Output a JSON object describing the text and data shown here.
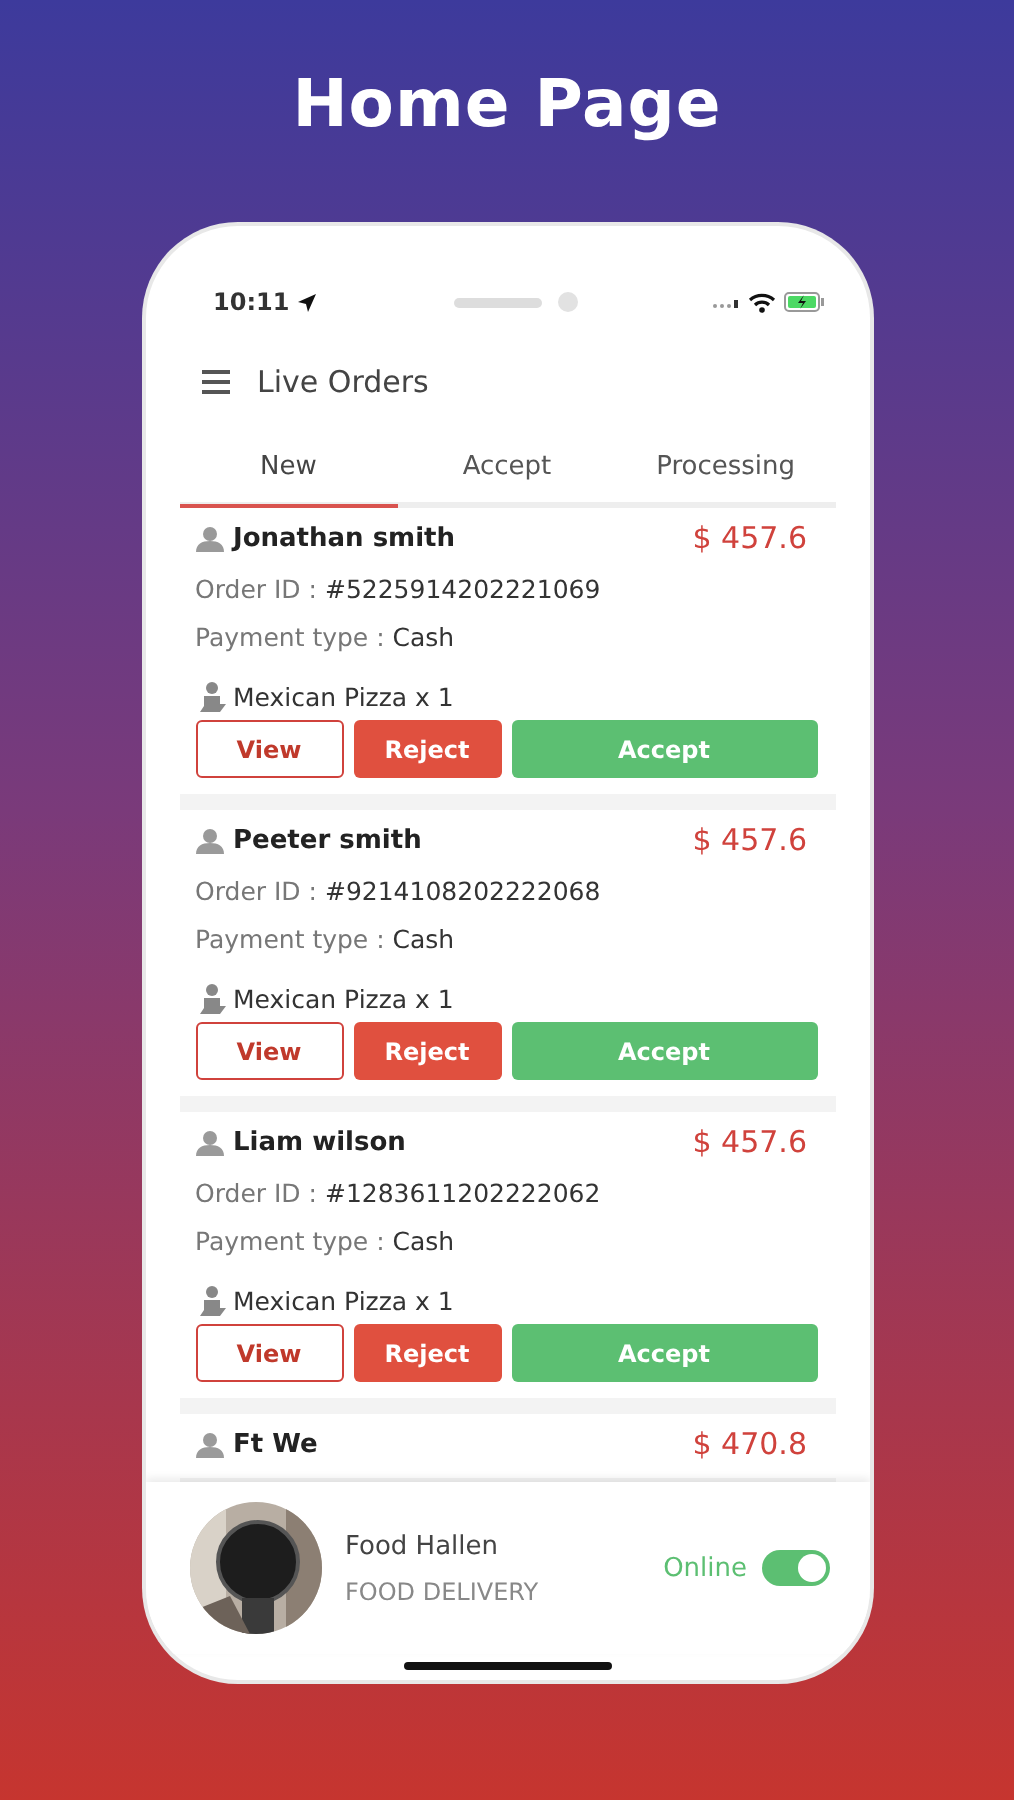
{
  "page_title": "Home Page",
  "status_bar": {
    "time": "10:11"
  },
  "header": {
    "title": "Live Orders"
  },
  "tabs": [
    {
      "label": "New",
      "selected": true
    },
    {
      "label": "Accept",
      "selected": false
    },
    {
      "label": "Processing",
      "selected": false
    }
  ],
  "orders": [
    {
      "name": "Jonathan smith",
      "price": "$ 457.6",
      "order_id_label": "Order ID :",
      "order_id": "#5225914202221069",
      "payment_label": "Payment type :",
      "payment": "Cash",
      "item": "Mexican Pizza x 1",
      "actions": [
        {
          "label": "View",
          "kind": "outline"
        },
        {
          "label": "Reject",
          "kind": "danger"
        },
        {
          "label": "Accept",
          "kind": "success"
        }
      ]
    },
    {
      "name": "Peeter smith",
      "price": "$ 457.6",
      "order_id_label": "Order ID :",
      "order_id": "#9214108202222068",
      "payment_label": "Payment type :",
      "payment": "Cash",
      "item": "Mexican Pizza x 1",
      "actions": [
        {
          "label": "View",
          "kind": "outline"
        },
        {
          "label": "Reject",
          "kind": "danger"
        },
        {
          "label": "Accept",
          "kind": "success"
        }
      ]
    },
    {
      "name": "Liam wilson",
      "price": "$ 457.6",
      "order_id_label": "Order ID :",
      "order_id": "#1283611202222062",
      "payment_label": "Payment type :",
      "payment": "Cash",
      "item": "Mexican Pizza x 1",
      "actions": [
        {
          "label": "View",
          "kind": "outline"
        },
        {
          "label": "Reject",
          "kind": "danger"
        },
        {
          "label": "Accept",
          "kind": "success"
        }
      ]
    },
    {
      "name": "Ft We",
      "price": "$ 470.8"
    }
  ],
  "store": {
    "name": "Food Hallen",
    "subtitle": "FOOD DELIVERY",
    "status_label": "Online",
    "online": true
  }
}
